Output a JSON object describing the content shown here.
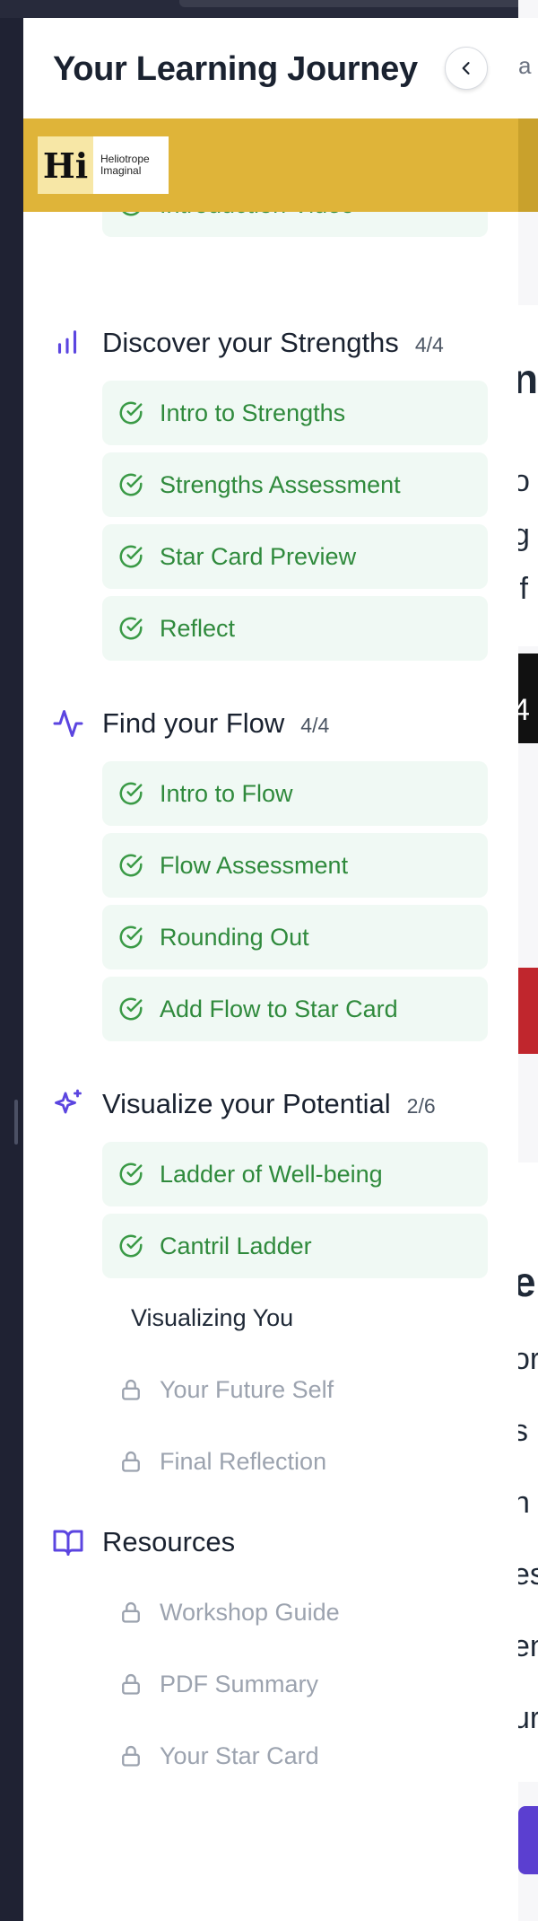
{
  "drawer": {
    "title": "Your Learning Journey",
    "collapse_icon": "chevron-left-icon"
  },
  "brand": {
    "logo_mark": "Hi",
    "logo_line1": "Heliotrope",
    "logo_line2": "Imaginal",
    "band_color": "#dfb439"
  },
  "colors": {
    "accent": "#5b45e0",
    "done_text": "#2f8a3c",
    "done_bg": "#f0f9f4",
    "locked_text": "#9ca3af"
  },
  "partial_item": {
    "label": "Introduction Video",
    "status": "done"
  },
  "sections": [
    {
      "title": "Discover your Strengths",
      "count": "4/4",
      "icon": "bar-chart-icon",
      "items": [
        {
          "label": "Intro to Strengths",
          "status": "done"
        },
        {
          "label": "Strengths Assessment",
          "status": "done"
        },
        {
          "label": "Star Card Preview",
          "status": "done"
        },
        {
          "label": "Reflect",
          "status": "done"
        }
      ]
    },
    {
      "title": "Find your Flow",
      "count": "4/4",
      "icon": "activity-icon",
      "items": [
        {
          "label": "Intro to Flow",
          "status": "done"
        },
        {
          "label": "Flow Assessment",
          "status": "done"
        },
        {
          "label": "Rounding Out",
          "status": "done"
        },
        {
          "label": "Add Flow to Star Card",
          "status": "done"
        }
      ]
    },
    {
      "title": "Visualize your Potential",
      "count": "2/6",
      "icon": "sparkles-icon",
      "items": [
        {
          "label": "Ladder of Well-being",
          "status": "done"
        },
        {
          "label": "Cantril Ladder",
          "status": "done"
        },
        {
          "label": "Visualizing You",
          "status": "current"
        },
        {
          "label": "Your Future Self",
          "status": "locked"
        },
        {
          "label": "Final Reflection",
          "status": "locked"
        }
      ]
    },
    {
      "title": "Resources",
      "count": "",
      "icon": "book-open-icon",
      "items": [
        {
          "label": "Workshop Guide",
          "status": "locked"
        },
        {
          "label": "PDF Summary",
          "status": "locked"
        },
        {
          "label": "Your Star Card",
          "status": "locked"
        }
      ]
    }
  ],
  "background": {
    "header_fragment": "a",
    "fragments": [
      "n",
      "o",
      "g",
      "if",
      "4",
      "e",
      "or",
      "s",
      "n",
      "es",
      "en",
      "ur"
    ]
  }
}
